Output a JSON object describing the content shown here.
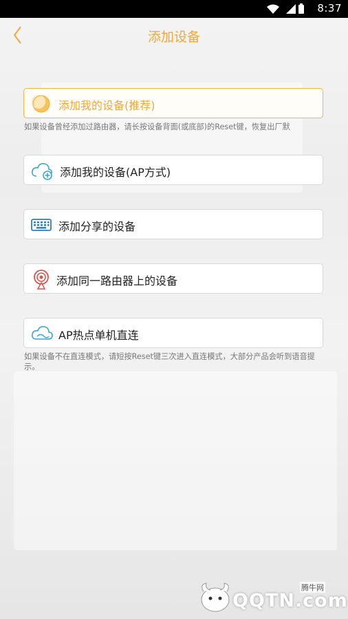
{
  "statusbar": {
    "time": "8:37"
  },
  "header": {
    "title": "添加设备"
  },
  "options": [
    {
      "label": "添加我的设备(推荐)",
      "icon": "moon-icon"
    },
    {
      "label": "添加我的设备(AP方式)",
      "icon": "cloud-plus-icon"
    },
    {
      "label": "添加分享的设备",
      "icon": "keyboard-icon"
    },
    {
      "label": "添加同一路由器上的设备",
      "icon": "router-pin-icon"
    },
    {
      "label": "AP热点单机直连",
      "icon": "cloud-icon"
    }
  ],
  "hints": {
    "recommended": "如果设备曾经添加过路由器，请长按设备背面(或底部)的Reset键，恢复出厂默",
    "ap_direct": "如果设备不在直连模式，请短按Reset键三次进入直连模式，大部分产品会听到语音提示。"
  },
  "watermark": {
    "brand": "QQTN.com",
    "sub": "腾牛网"
  },
  "colors": {
    "accent": "#f0a93a",
    "icon_blue": "#3aa3d8",
    "icon_red": "#e0524a"
  }
}
